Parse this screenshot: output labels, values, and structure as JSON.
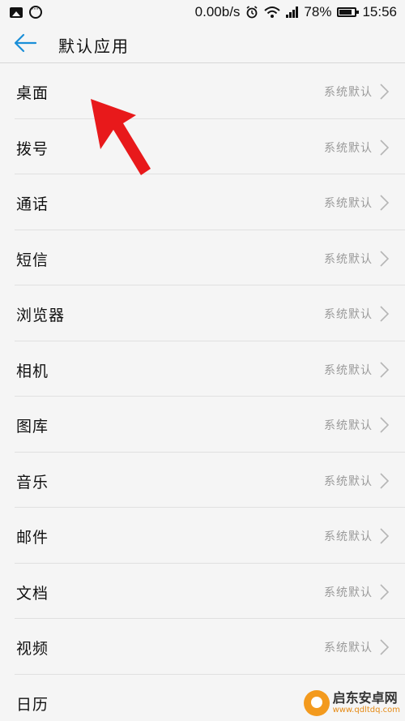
{
  "status_bar": {
    "network_speed": "0.00b/s",
    "battery": "78%",
    "time": "15:56",
    "icons": [
      "image-icon",
      "more-dots-icon",
      "alarm-icon",
      "wifi-icon",
      "signal-icon",
      "battery-icon"
    ]
  },
  "app_bar": {
    "back_icon": "back-arrow-icon",
    "title": "默认应用"
  },
  "items": [
    {
      "label": "桌面",
      "value": "系统默认"
    },
    {
      "label": "拨号",
      "value": "系统默认"
    },
    {
      "label": "通话",
      "value": "系统默认"
    },
    {
      "label": "短信",
      "value": "系统默认"
    },
    {
      "label": "浏览器",
      "value": "系统默认"
    },
    {
      "label": "相机",
      "value": "系统默认"
    },
    {
      "label": "图库",
      "value": "系统默认"
    },
    {
      "label": "音乐",
      "value": "系统默认"
    },
    {
      "label": "邮件",
      "value": "系统默认"
    },
    {
      "label": "文档",
      "value": "系统默认"
    },
    {
      "label": "视频",
      "value": "系统默认"
    },
    {
      "label": "日历",
      "value": ""
    }
  ],
  "colors": {
    "accent": "#1a8fd8",
    "annotation_arrow": "#e8191b",
    "secondary_text": "#9a9a9a"
  },
  "watermark": {
    "name": "启东安卓网",
    "url": "www.qdltdq.com"
  }
}
